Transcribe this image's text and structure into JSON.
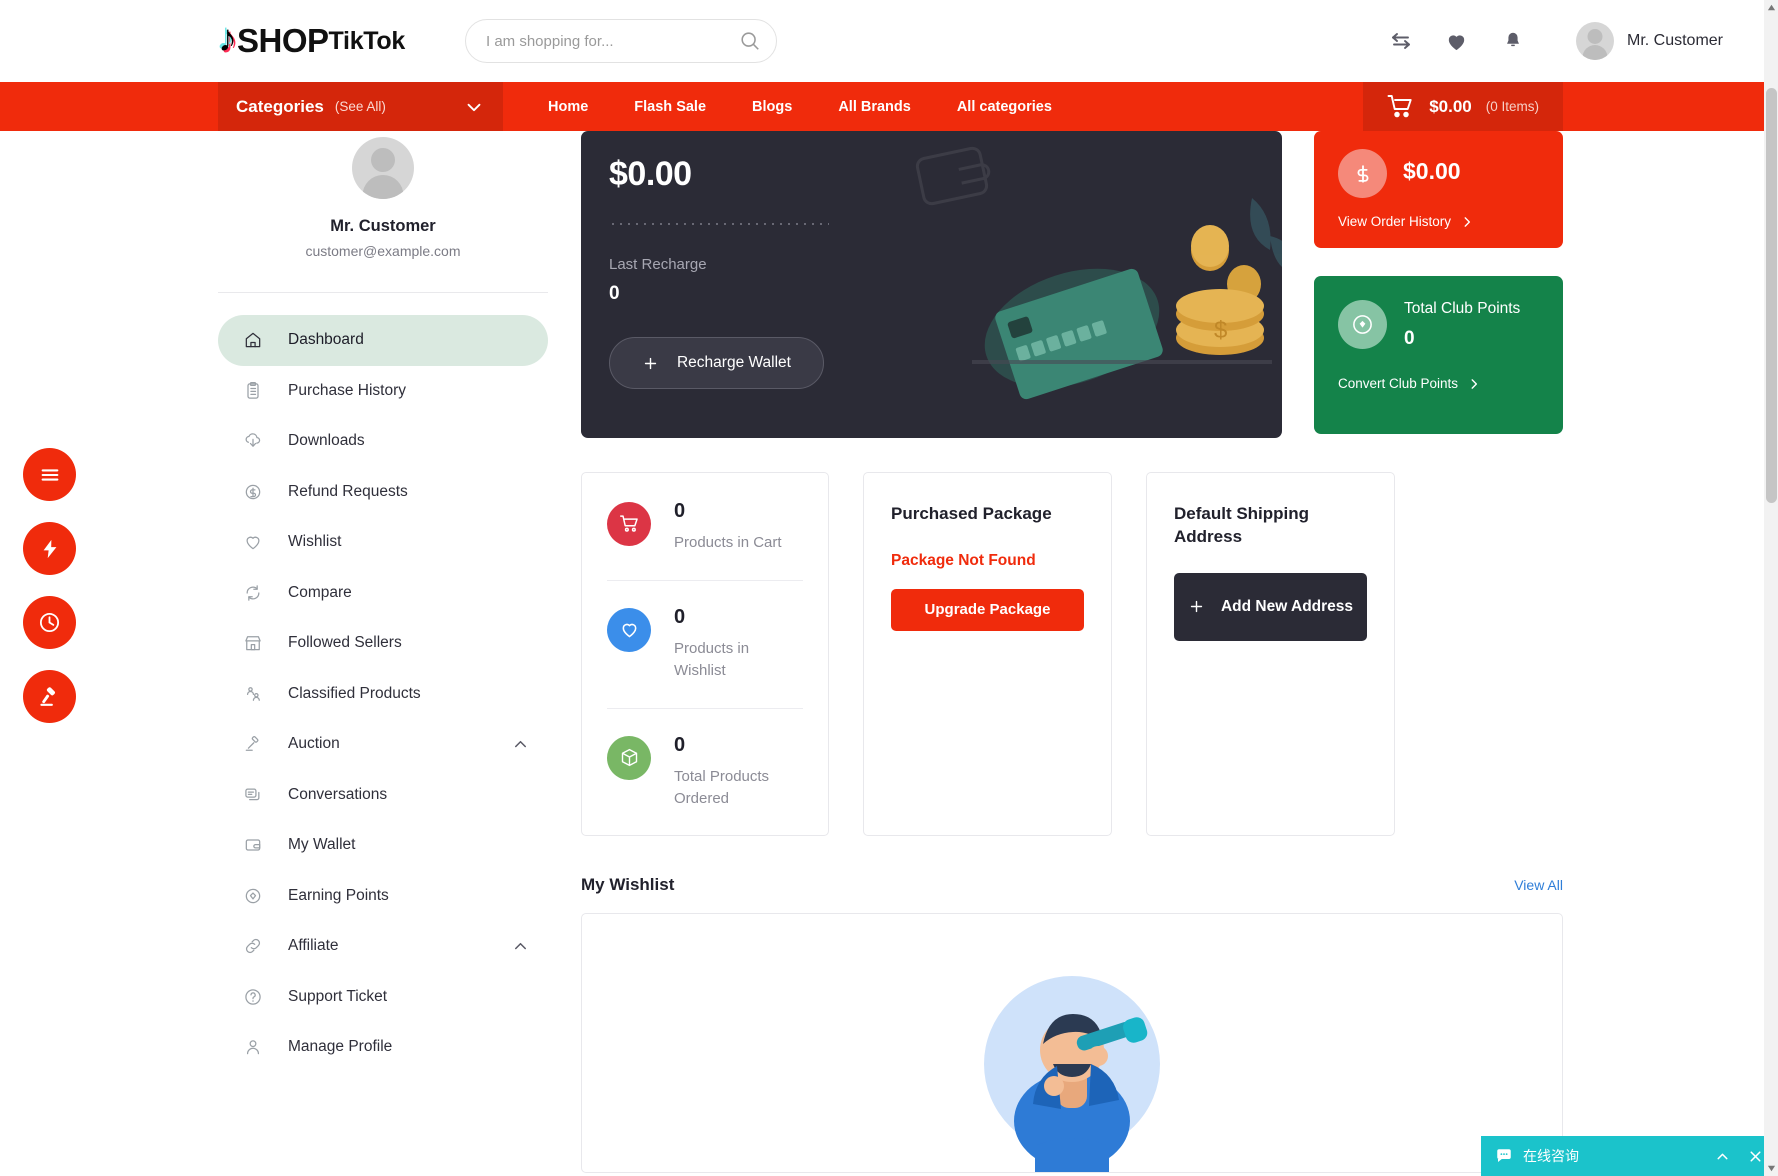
{
  "header": {
    "logo": {
      "note": "♪",
      "shop": "SHOP",
      "tiktok": "TikTok"
    },
    "search": {
      "placeholder": "I am shopping for...",
      "value": ""
    },
    "user_name": "Mr. Customer"
  },
  "nav": {
    "categories_label": "Categories",
    "see_all": "(See All)",
    "links": [
      "Home",
      "Flash Sale",
      "Blogs",
      "All Brands",
      "All categories"
    ],
    "cart_amount": "$0.00",
    "cart_items": "(0 Items)"
  },
  "sidebar": {
    "profile": {
      "name": "Mr. Customer",
      "email": "customer@example.com"
    },
    "items": [
      {
        "label": "Dashboard",
        "icon": "home-icon",
        "active": true,
        "chevron": ""
      },
      {
        "label": "Purchase History",
        "icon": "clipboard-icon",
        "active": false,
        "chevron": ""
      },
      {
        "label": "Downloads",
        "icon": "download-icon",
        "active": false,
        "chevron": ""
      },
      {
        "label": "Refund Requests",
        "icon": "refund-icon",
        "active": false,
        "chevron": ""
      },
      {
        "label": "Wishlist",
        "icon": "heart-icon",
        "active": false,
        "chevron": ""
      },
      {
        "label": "Compare",
        "icon": "compare-icon",
        "active": false,
        "chevron": ""
      },
      {
        "label": "Followed Sellers",
        "icon": "store-icon",
        "active": false,
        "chevron": ""
      },
      {
        "label": "Classified Products",
        "icon": "classified-icon",
        "active": false,
        "chevron": ""
      },
      {
        "label": "Auction",
        "icon": "gavel-icon",
        "active": false,
        "chevron": "up"
      },
      {
        "label": "Conversations",
        "icon": "chat-icon",
        "active": false,
        "chevron": ""
      },
      {
        "label": "My Wallet",
        "icon": "wallet-icon",
        "active": false,
        "chevron": ""
      },
      {
        "label": "Earning Points",
        "icon": "points-icon",
        "active": false,
        "chevron": ""
      },
      {
        "label": "Affiliate",
        "icon": "link-icon",
        "active": false,
        "chevron": "up"
      },
      {
        "label": "Support Ticket",
        "icon": "support-icon",
        "active": false,
        "chevron": ""
      },
      {
        "label": "Manage Profile",
        "icon": "profile-icon",
        "active": false,
        "chevron": ""
      }
    ]
  },
  "wallet": {
    "amount": "$0.00",
    "last_recharge_label": "Last Recharge",
    "last_recharge_value": "0",
    "recharge_button": "Recharge Wallet"
  },
  "order_card": {
    "amount": "$0.00",
    "link": "View Order History"
  },
  "club_card": {
    "title": "Total Club Points",
    "value": "0",
    "link": "Convert Club Points"
  },
  "stats": [
    {
      "value": "0",
      "label": "Products in Cart",
      "icon": "cart-icon",
      "color": "#DC3545"
    },
    {
      "value": "0",
      "label": "Products in Wishlist",
      "icon": "heart-icon",
      "color": "#3B8EEA"
    },
    {
      "value": "0",
      "label": "Total Products Ordered",
      "icon": "package-icon",
      "color": "#79B765"
    }
  ],
  "package_card": {
    "title": "Purchased Package",
    "status": "Package Not Found",
    "button": "Upgrade Package"
  },
  "address_card": {
    "title": "Default Shipping Address",
    "button": "Add New Address"
  },
  "wishlist_section": {
    "title": "My Wishlist",
    "view_all": "View All"
  },
  "fabs": [
    {
      "icon": "menu-icon"
    },
    {
      "icon": "flash-icon"
    },
    {
      "icon": "clock-icon"
    },
    {
      "icon": "gavel-icon"
    }
  ],
  "chat_widget": {
    "label": "在线咨询",
    "collapse": "⌃",
    "close": "✕"
  },
  "colors": {
    "brand_red": "#F02B0C",
    "brand_red_dark": "#D4260B",
    "dark_card": "#2B2B36",
    "green_card": "#14834A",
    "active_menu": "#DAE9E0",
    "link_blue": "#2F7ED8",
    "chat_teal": "#1BC3CB"
  }
}
